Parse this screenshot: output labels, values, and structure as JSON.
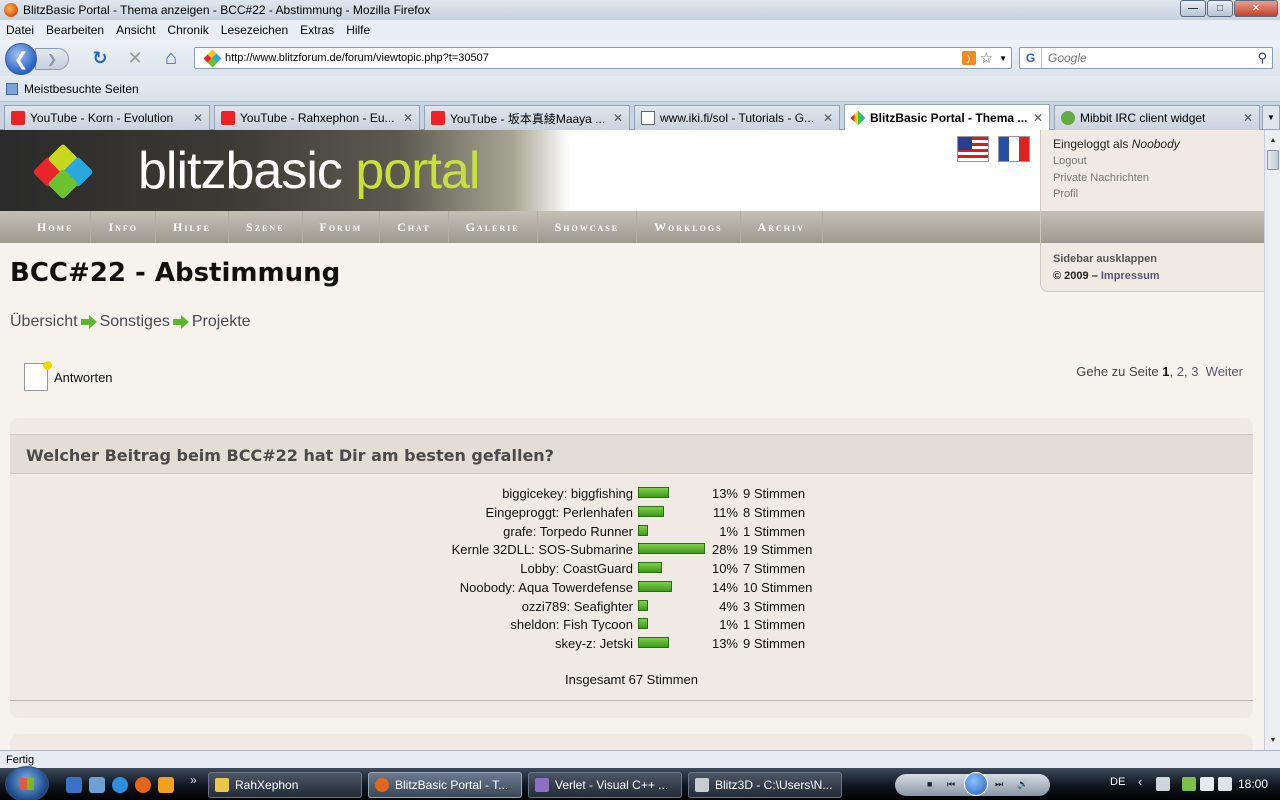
{
  "window": {
    "title": "BlitzBasic Portal - Thema anzeigen - BCC#22 - Abstimmung - Mozilla Firefox",
    "minimize_glyph": "—",
    "maximize_glyph": "□",
    "close_glyph": "✕"
  },
  "menu": {
    "items": [
      "Datei",
      "Bearbeiten",
      "Ansicht",
      "Chronik",
      "Lesezeichen",
      "Extras",
      "Hilfe"
    ]
  },
  "navbar": {
    "back_glyph": "❮",
    "forward_glyph": "❯",
    "reload_glyph": "↻",
    "stop_glyph": "✕",
    "home_glyph": "⌂",
    "url": "http://www.blitzforum.de/forum/viewtopic.php?t=30507",
    "search_engine": "G",
    "search_placeholder": "Google",
    "search_glyph": "⚲"
  },
  "bookmarks": {
    "item": "Meistbesuchte Seiten"
  },
  "tabs": [
    {
      "label": "YouTube - Korn - Evolution",
      "icon": "youtube-icon",
      "active": false
    },
    {
      "label": "YouTube - Rahxephon - Eu...",
      "icon": "youtube-icon",
      "active": false
    },
    {
      "label": "YouTube - 坂本真綾Maaya ...",
      "icon": "youtube-icon",
      "active": false
    },
    {
      "label": "www.iki.fi/sol - Tutorials - G...",
      "icon": "document-icon",
      "active": false
    },
    {
      "label": "BlitzBasic Portal - Thema ...",
      "icon": "blitzbasic-icon",
      "active": true
    },
    {
      "label": "Mibbit IRC client widget",
      "icon": "mibbit-icon",
      "active": false
    }
  ],
  "tab_close_glyph": "✕",
  "site": {
    "logo_word1": "blitzbasic",
    "logo_word2": "portal",
    "logo_colors": [
      "#e8262c",
      "#f7c11d",
      "#6bc331",
      "#29a8e0"
    ],
    "nav": [
      "Home",
      "Info",
      "Hilfe",
      "Szene",
      "Forum",
      "Chat",
      "Galerie",
      "Showcase",
      "Worklogs",
      "Archiv"
    ]
  },
  "sidebar": {
    "logged_in_prefix": "Eingeloggt als",
    "username": "Noobody",
    "logout": "Logout",
    "private_messages": "Private Nachrichten",
    "profile": "Profil",
    "expand": "Sidebar ausklappen",
    "copyright": "© 2009 –",
    "imprint": "Impressum"
  },
  "topic": {
    "title": "BCC#22 - Abstimmung",
    "breadcrumb": [
      "Übersicht",
      "Sonstiges",
      "Projekte"
    ],
    "reply_label": "Antworten",
    "pagination_prefix": "Gehe zu Seite",
    "pages": [
      "1",
      "2",
      "3"
    ],
    "next": "Weiter"
  },
  "poll": {
    "question": "Welcher Beitrag beim BCC#22 hat Dir am besten gefallen?",
    "options": [
      {
        "label": "biggicekey: biggfishing",
        "percent": 13,
        "pct_text": "13%",
        "votes_text": "9 Stimmen"
      },
      {
        "label": "Eingeproggt: Perlenhafen",
        "percent": 11,
        "pct_text": "11%",
        "votes_text": "8 Stimmen"
      },
      {
        "label": "grafe: Torpedo Runner",
        "percent": 1,
        "pct_text": "1%",
        "votes_text": "1 Stimmen"
      },
      {
        "label": "Kernle 32DLL: SOS-Submarine",
        "percent": 28,
        "pct_text": "28%",
        "votes_text": "19 Stimmen"
      },
      {
        "label": "Lobby: CoastGuard",
        "percent": 10,
        "pct_text": "10%",
        "votes_text": "7 Stimmen"
      },
      {
        "label": "Noobody: Aqua Towerdefense",
        "percent": 14,
        "pct_text": "14%",
        "votes_text": "10 Stimmen"
      },
      {
        "label": "ozzi789: Seafighter",
        "percent": 4,
        "pct_text": "4%",
        "votes_text": "3 Stimmen"
      },
      {
        "label": "sheldon: Fish Tycoon",
        "percent": 1,
        "pct_text": "1%",
        "votes_text": "1 Stimmen"
      },
      {
        "label": "skey-z: Jetski",
        "percent": 13,
        "pct_text": "13%",
        "votes_text": "9 Stimmen"
      }
    ],
    "total": "Insgesamt 67 Stimmen"
  },
  "status": {
    "text": "Fertig"
  },
  "taskbar": {
    "more_glyph": "»",
    "tasks": [
      {
        "label": "RahXephon",
        "active": false
      },
      {
        "label": "BlitzBasic Portal - T...",
        "active": true
      },
      {
        "label": "Verlet - Visual C++ ...",
        "active": false
      },
      {
        "label": "Blitz3D - C:\\Users\\N...",
        "active": false
      }
    ],
    "media_controls": [
      "■",
      "⏮",
      "⏭",
      "🔊"
    ],
    "language": "DE",
    "tray_arrow_glyph": "‹",
    "clock": "18:00"
  }
}
